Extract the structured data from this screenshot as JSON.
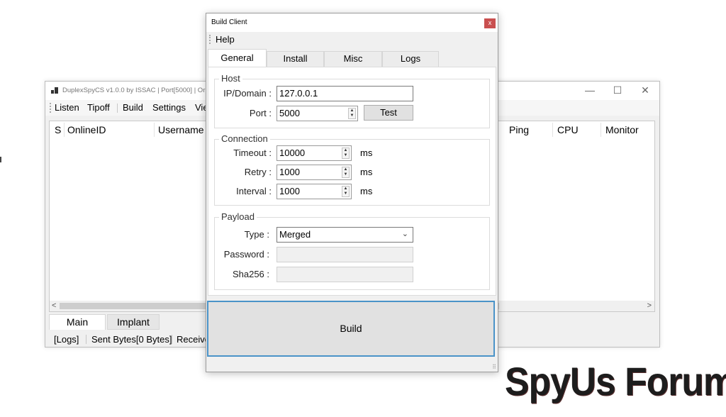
{
  "main_window": {
    "title": "DuplexSpyCS v1.0.0 by ISSAC | Port[5000] | Or",
    "menu": [
      "Listen",
      "Tipoff",
      "Build",
      "Settings",
      "Vie"
    ],
    "columns_left": [
      "S",
      "OnlineID",
      "Username"
    ],
    "columns_right": [
      "Ping",
      "CPU",
      "Monitor"
    ],
    "tabs": [
      "Main",
      "Implant"
    ],
    "status": [
      "[Logs]",
      "Sent Bytes[0 Bytes]",
      "Receive"
    ],
    "controls": {
      "minimize": "—",
      "maximize": "☐",
      "close": "✕"
    },
    "scroll": {
      "left": "<",
      "right": ">"
    }
  },
  "dialog": {
    "title": "Build Client",
    "close": "x",
    "menu": [
      "Help"
    ],
    "tabs": [
      {
        "label": "General",
        "active": true
      },
      {
        "label": "Install",
        "active": false
      },
      {
        "label": "Misc",
        "active": false
      },
      {
        "label": "Logs",
        "active": false
      }
    ],
    "host": {
      "title": "Host",
      "ip_label": "IP/Domain :",
      "ip_value": "127.0.0.1",
      "port_label": "Port :",
      "port_value": "5000",
      "test_label": "Test"
    },
    "connection": {
      "title": "Connection",
      "timeout_label": "Timeout :",
      "timeout_value": "10000",
      "retry_label": "Retry :",
      "retry_value": "1000",
      "interval_label": "Interval :",
      "interval_value": "1000",
      "unit": "ms"
    },
    "payload": {
      "title": "Payload",
      "type_label": "Type :",
      "type_value": "Merged",
      "password_label": "Password :",
      "password_value": "",
      "sha_label": "Sha256 :",
      "sha_value": ""
    },
    "build_label": "Build"
  },
  "watermark": "SpyUs Forum",
  "colors": {
    "close_red": "#c94f4f",
    "focus_blue": "#4a93c8"
  }
}
